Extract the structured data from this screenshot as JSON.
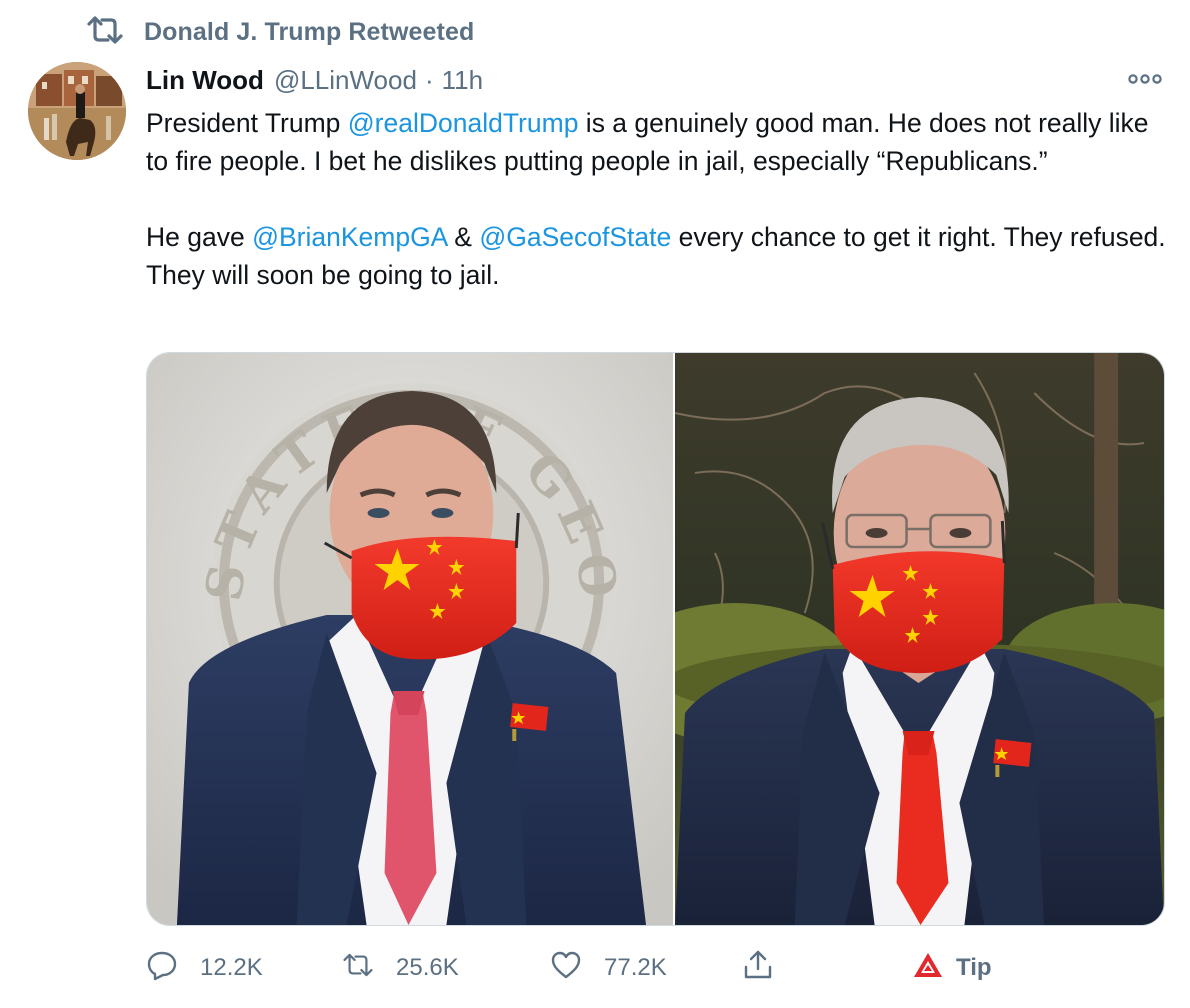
{
  "retweet_context": {
    "label": "Donald J. Trump Retweeted",
    "icon": "retweet-icon"
  },
  "tweet": {
    "author": {
      "name": "Lin Wood",
      "handle": "@LLinWood",
      "avatar_icon": "avatar"
    },
    "separator": "·",
    "time": "11h",
    "more_icon": "more-icon",
    "text": {
      "p1_a": "President Trump ",
      "p1_mention": "@realDonaldTrump",
      "p1_b": " is a genuinely good man. He does not really like to fire people. I bet he dislikes putting people in jail, especially “Republicans.”",
      "p2_a": "He gave ",
      "p2_mention1": "@BrianKempGA",
      "p2_b": " & ",
      "p2_mention2": "@GaSecofState",
      "p2_c": " every chance to get it right. They refused. They will soon be going to jail."
    },
    "media": {
      "left_seal_text": "STATE OF GEORGIA"
    },
    "actions": {
      "reply_count": "12.2K",
      "retweet_count": "25.6K",
      "like_count": "77.2K",
      "tip_label": "Tip"
    }
  },
  "colors": {
    "mention": "#1b95e0",
    "secondary_text": "#5b7083",
    "primary_text": "#0f1419",
    "mask_red": "#e8281f",
    "star_yellow": "#ffd200",
    "tip_red": "#e0282d"
  }
}
